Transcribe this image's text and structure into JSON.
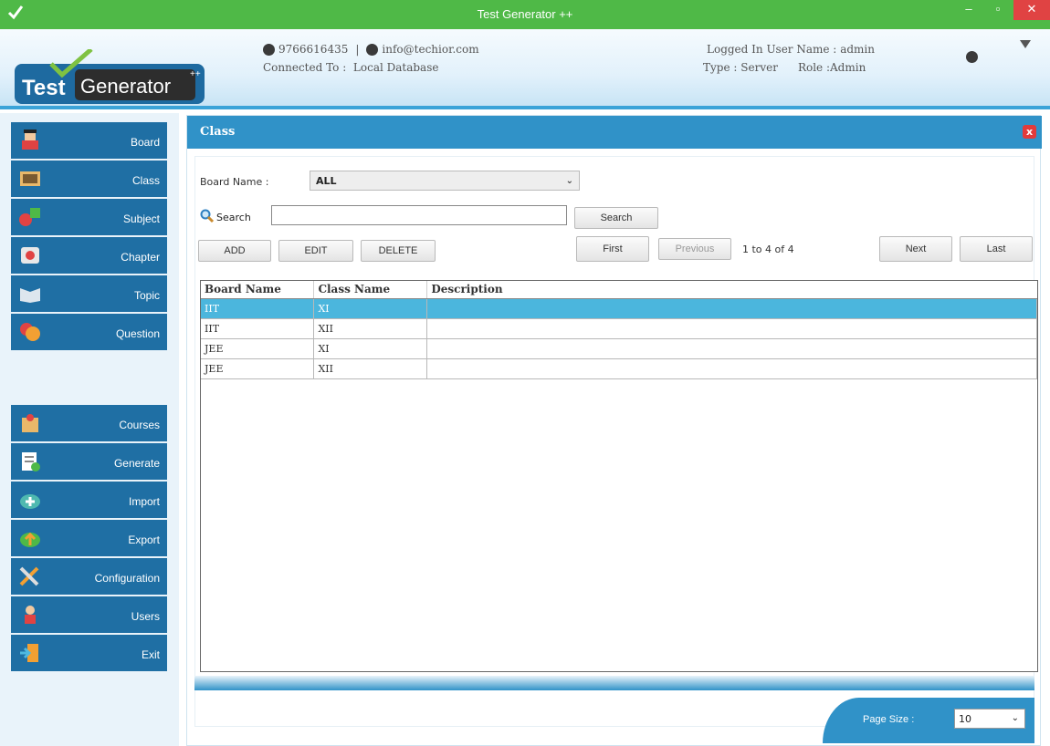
{
  "window": {
    "title": "Test Generator ++",
    "min_label": "‒",
    "max_label": "▫",
    "close_label": "✕"
  },
  "header": {
    "logo_part1": "Test",
    "logo_part2": "Generator",
    "logo_sup": "++",
    "phone": "9766616435",
    "separator": "|",
    "email": "info@techior.com",
    "connected_label": "Connected To :",
    "connected_value": "Local Database",
    "user_label": "Logged In User Name :",
    "user_value": "admin",
    "type_label": "Type :",
    "type_value": "Server",
    "role_label": "Role :",
    "role_value": "Admin"
  },
  "sidebar": {
    "primary": [
      {
        "label": "Board",
        "icon": "board-icon"
      },
      {
        "label": "Class",
        "icon": "class-icon"
      },
      {
        "label": "Subject",
        "icon": "subject-icon"
      },
      {
        "label": "Chapter",
        "icon": "chapter-icon"
      },
      {
        "label": "Topic",
        "icon": "topic-icon"
      },
      {
        "label": "Question",
        "icon": "question-icon"
      }
    ],
    "secondary": [
      {
        "label": "Courses",
        "icon": "courses-icon"
      },
      {
        "label": "Generate",
        "icon": "generate-icon"
      },
      {
        "label": "Import",
        "icon": "import-icon"
      },
      {
        "label": "Export",
        "icon": "export-icon"
      },
      {
        "label": "Configuration",
        "icon": "configuration-icon"
      },
      {
        "label": "Users",
        "icon": "users-icon"
      },
      {
        "label": "Exit",
        "icon": "exit-icon"
      }
    ]
  },
  "panel": {
    "title": "Class",
    "board_label": "Board Name :",
    "board_value": "ALL",
    "search_label": "Search",
    "search_value": "",
    "search_button": "Search",
    "add_button": "ADD",
    "edit_button": "EDIT",
    "delete_button": "DELETE",
    "first_button": "First",
    "previous_button": "Previous",
    "pager_text": "1 to 4 of 4",
    "next_button": "Next",
    "last_button": "Last",
    "page_size_label": "Page Size :",
    "page_size_value": "10"
  },
  "table": {
    "columns": [
      "Board Name",
      "Class Name",
      "Description"
    ],
    "rows": [
      [
        "IIT",
        "XI",
        ""
      ],
      [
        "IIT",
        "XII",
        ""
      ],
      [
        "JEE",
        "XI",
        ""
      ],
      [
        "JEE",
        "XII",
        ""
      ]
    ],
    "selected_row": 0
  },
  "colors": {
    "titlebar": "#4fb947",
    "accent": "#3092c8",
    "nav": "#1f6fa4",
    "selection": "#4bb6dd",
    "close": "#e04343"
  }
}
